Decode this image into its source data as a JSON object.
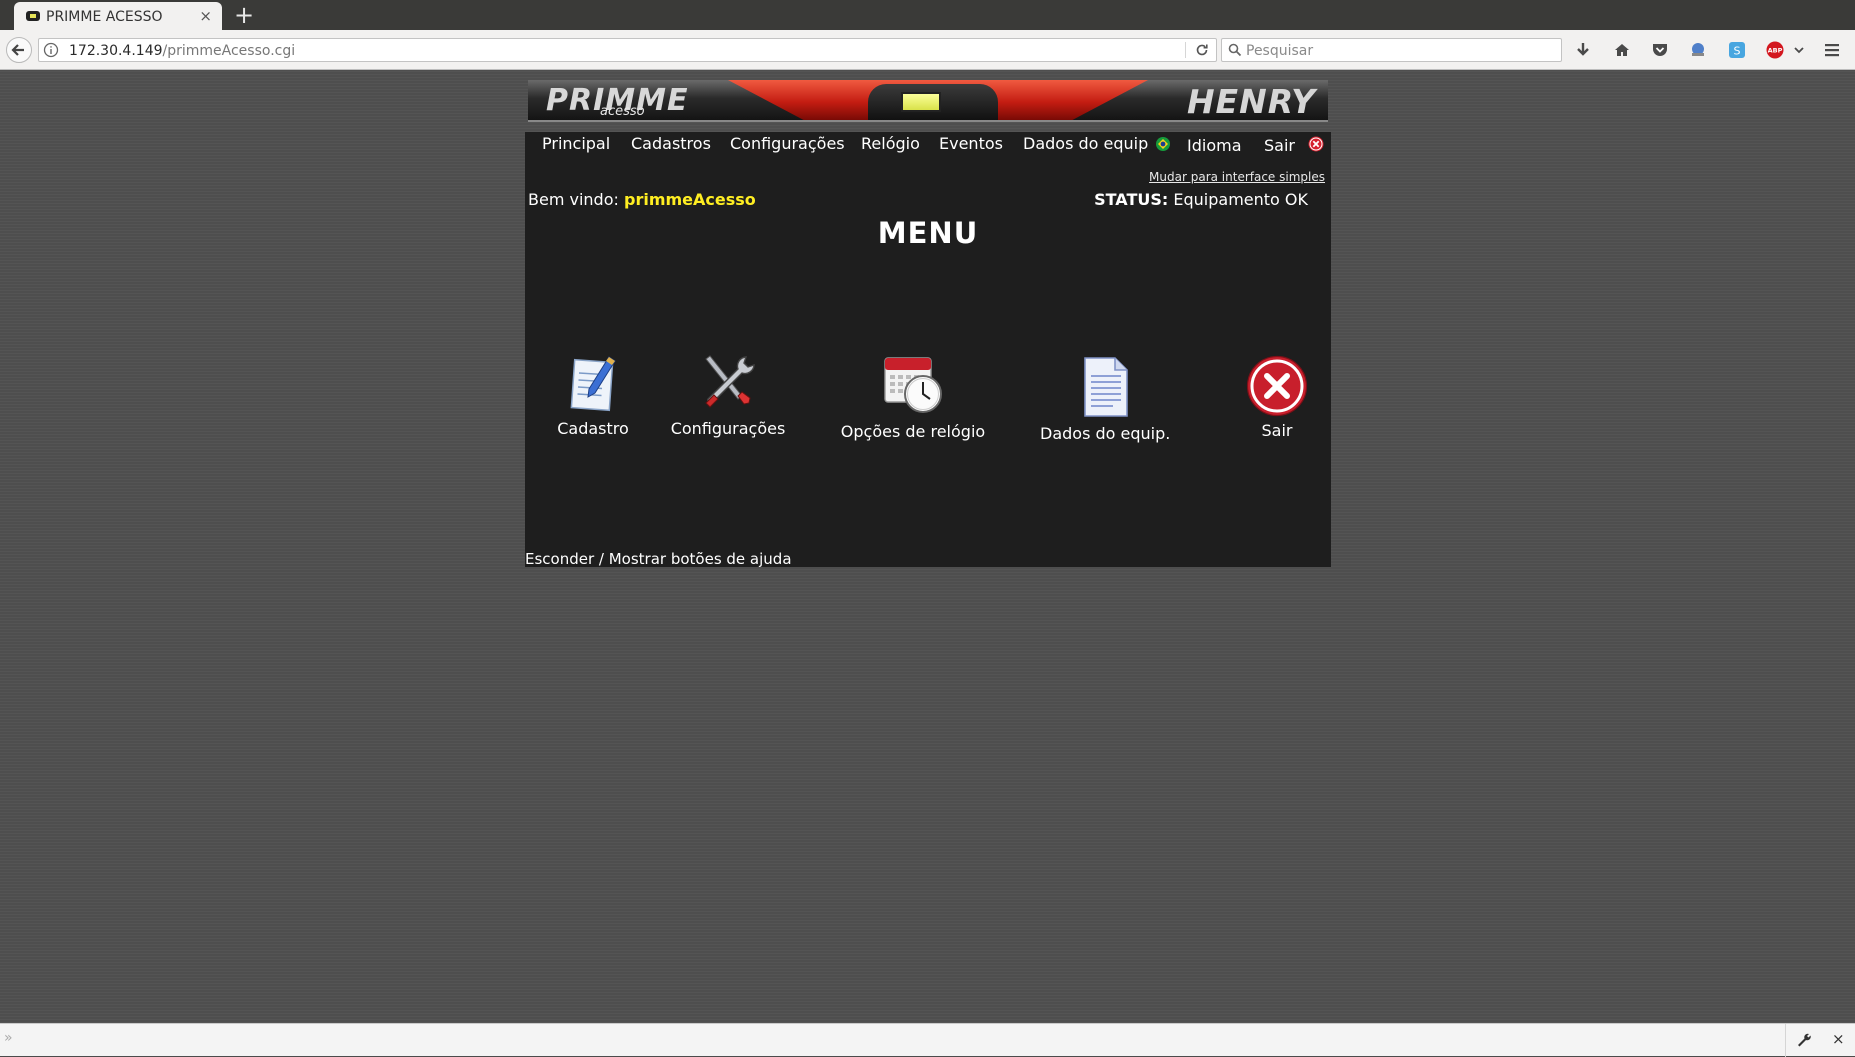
{
  "browser": {
    "tab_title": "PRIMME ACESSO",
    "tab_close": "×",
    "new_tab": "+",
    "url_host": "172.30.4.149",
    "url_path": "/primmeAcesso.cgi",
    "search_placeholder": "Pesquisar",
    "toolbar_icons": [
      "download-icon",
      "home-icon",
      "pocket-icon",
      "extension-icon",
      "skype-icon",
      "adblock-icon",
      "chevron-down-icon",
      "hamburger-menu-icon"
    ],
    "adblock_label": "ABP"
  },
  "header": {
    "logo_left": "PRIMME",
    "logo_left_sub": "acesso",
    "logo_right": "HENRY"
  },
  "topmenu": {
    "items": [
      "Principal",
      "Cadastros",
      "Configurações",
      "Relógio",
      "Eventos",
      "Dados do equip"
    ],
    "idioma": "Idioma",
    "sair": "Sair"
  },
  "simple_interface_link": "Mudar para interface simples",
  "welcome": {
    "label": "Bem vindo:",
    "user": "primmeAcesso"
  },
  "status": {
    "label": "STATUS:",
    "value": "Equipamento OK"
  },
  "menu_title": "MENU",
  "menu_items": [
    {
      "label": "Cadastro",
      "icon": "edit-document-icon"
    },
    {
      "label": "Configurações",
      "icon": "tools-icon"
    },
    {
      "label": "Opções de relógio",
      "icon": "calendar-clock-icon"
    },
    {
      "label": "Dados do equip.",
      "icon": "document-icon"
    },
    {
      "label": "Sair",
      "icon": "exit-icon"
    }
  ],
  "help_toggle": "Esconder / Mostrar botões de ajuda",
  "colors": {
    "panel_bg": "#1e1e1e",
    "user_highlight": "#ffee22",
    "page_bg": "#4e4e4e"
  }
}
